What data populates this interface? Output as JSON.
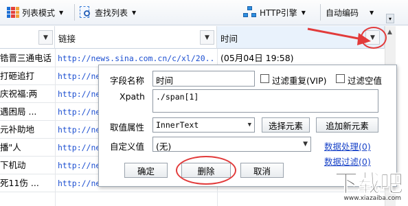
{
  "toolbar": {
    "list_mode_label": "列表模式",
    "find_list_label": "查找列表",
    "http_engine_label": "HTTP引擎",
    "auto_encoding_label": "自动编码"
  },
  "columns": [
    {
      "label": ""
    },
    {
      "label": "链接"
    },
    {
      "label": "时间"
    }
  ],
  "rows": [
    {
      "title": "锆晋三通电话",
      "link": "http://news.sina.com.cn/c/xl/20...",
      "time": "(05月04日 19:58)"
    },
    {
      "title": "打砸追打",
      "link": "http://ne",
      "time": ""
    },
    {
      "title": "庆祝福:两",
      "link": "http://ne",
      "time": ""
    },
    {
      "title": "遇困局 ...",
      "link": "http://ne",
      "time": ""
    },
    {
      "title": "元补助地",
      "link": "http://ne",
      "time": ""
    },
    {
      "title": "播\"人",
      "link": "http://ne",
      "time": ""
    },
    {
      "title": "下机动",
      "link": "http://ne",
      "time": ""
    },
    {
      "title": "死11伤 ...",
      "link": "http://ne",
      "time": ""
    }
  ],
  "dialog": {
    "field_name_label": "字段名称",
    "field_name_value": "时间",
    "filter_dup_label": "过滤重复(VIP)",
    "filter_empty_label": "过滤空值",
    "xpath_label": "Xpath",
    "xpath_value": "./span[1]",
    "attr_label": "取值属性",
    "attr_value": "InnerText",
    "select_element_label": "选择元素",
    "add_element_label": "追加新元素",
    "custom_value_label": "自定义值",
    "custom_value_value": "(无)",
    "data_process_label": "数据处理(0)",
    "data_filter_label": "数据过滤(0)",
    "ok_label": "确定",
    "delete_label": "删除",
    "cancel_label": "取消"
  },
  "watermark": {
    "text": "下载吧",
    "url": "www.xiazaiba.com"
  },
  "colors": {
    "annotation": "#e23b3b",
    "link": "#1c4fd1"
  }
}
